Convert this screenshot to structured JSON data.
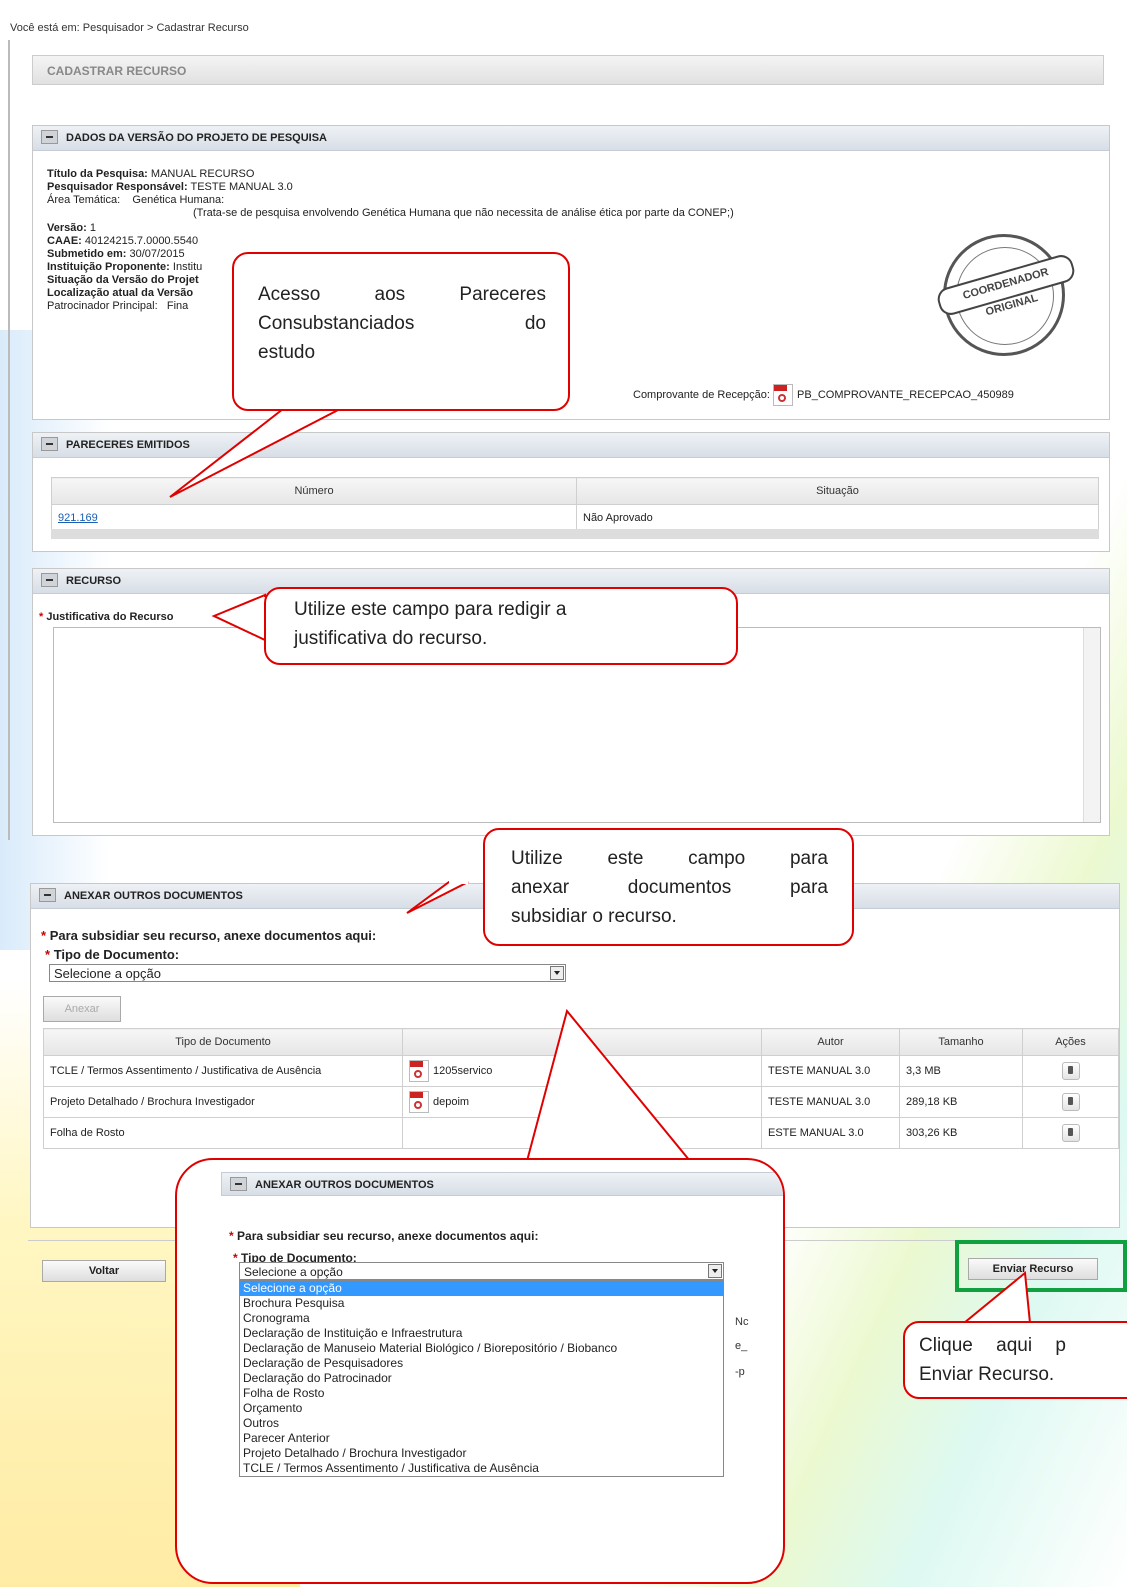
{
  "breadcrumb": "Você está em: Pesquisador > Cadastrar Recurso",
  "page_title": "CADASTRAR RECURSO",
  "dados": {
    "title": "DADOS DA VERSÃO DO PROJETO DE PESQUISA",
    "titulo_label": "Título da Pesquisa:",
    "titulo_value": "MANUAL RECURSO",
    "pesquisador_label": "Pesquisador Responsável:",
    "pesquisador_value": "TESTE MANUAL 3.0",
    "area_label": "Área Temática:",
    "area_value": "Genética Humana:",
    "area_note": "(Trata-se de pesquisa envolvendo Genética Humana que não necessita de análise ética por parte da CONEP;)",
    "versao_label": "Versão:",
    "versao_value": "1",
    "caae_label": "CAAE:",
    "caae_value": "40124215.7.0000.5540",
    "submetido_label": "Submetido em:",
    "submetido_value": "30/07/2015",
    "instituicao_label": "Instituição Proponente:",
    "instituicao_value": "Institu",
    "situacao_label": "Situação da Versão do Projet",
    "localizacao_label": "Localização atual da Versão",
    "patrocinador_label": "Patrocinador Principal:",
    "patrocinador_value": "Fina",
    "comprovante_label": "Comprovante de Recepção:",
    "comprovante_file": "PB_COMPROVANTE_RECEPCAO_450989",
    "stamp_text": "COORDENADOR ORIGINAL"
  },
  "pareceres": {
    "title": "PARECERES EMITIDOS",
    "columns": [
      "Número",
      "Situação"
    ],
    "rows": [
      {
        "numero": "921.169",
        "situacao": "Não Aprovado"
      }
    ]
  },
  "recurso": {
    "title": "RECURSO",
    "field_label": "Justificativa do Recurso"
  },
  "anexar": {
    "title": "ANEXAR OUTROS DOCUMENTOS",
    "intro": "Para subsidiar seu recurso, anexe documentos aqui:",
    "tipo_label": "Tipo de Documento:",
    "select_value": "Selecione a opção",
    "anexar_button": "Anexar",
    "columns": [
      "Tipo de Documento",
      "",
      "Autor",
      "Tamanho",
      "Ações"
    ],
    "rows": [
      {
        "tipo": "TCLE / Termos Assentimento / Justificativa de Ausência",
        "file": "1205servico",
        "autor": "TESTE MANUAL 3.0",
        "tamanho": "3,3 MB"
      },
      {
        "tipo": "Projeto Detalhado / Brochura Investigador",
        "file": "depoim",
        "autor": "TESTE MANUAL 3.0",
        "tamanho": "289,18 KB"
      },
      {
        "tipo": "Folha de Rosto",
        "file": "",
        "autor": "ESTE MANUAL 3.0",
        "tamanho": "303,26 KB"
      }
    ]
  },
  "buttons": {
    "voltar": "Voltar",
    "enviar": "Enviar Recurso"
  },
  "zoom": {
    "title": "ANEXAR OUTROS DOCUMENTOS",
    "intro": "Para subsidiar seu recurso, anexe documentos aqui:",
    "tipo_label": "Tipo de Documento:",
    "select_value": "Selecione a opção",
    "options": [
      "Selecione a opção",
      "Brochura Pesquisa",
      "Cronograma",
      "Declaração de Instituição e Infraestrutura",
      "Declaração de Manuseio Material Biológico / Biorepositório / Biobanco",
      "Declaração de Pesquisadores",
      "Declaração do Patrocinador",
      "Folha de Rosto",
      "Orçamento",
      "Outros",
      "Parecer Anterior",
      "Projeto Detalhado / Brochura Investigador",
      "TCLE / Termos Assentimento / Justificativa de Ausência"
    ],
    "peek_1": "Nc",
    "peek_2": "e_",
    "peek_3": "-p"
  },
  "callouts": {
    "pareceres": [
      "Acesso aos Pareceres",
      "Consubstanciados do",
      "estudo"
    ],
    "justificativa": [
      "Utilize este campo para redigir a",
      "justificativa do recurso."
    ],
    "anexar": [
      "Utilize este campo para",
      "anexar documentos para",
      "subsidiar o recurso."
    ],
    "enviar": [
      "Clique aqui p",
      "Enviar Recurso."
    ]
  },
  "colors": {
    "callout_border": "#e00000",
    "highlight": "#10a040",
    "link": "#1a5fb4"
  }
}
